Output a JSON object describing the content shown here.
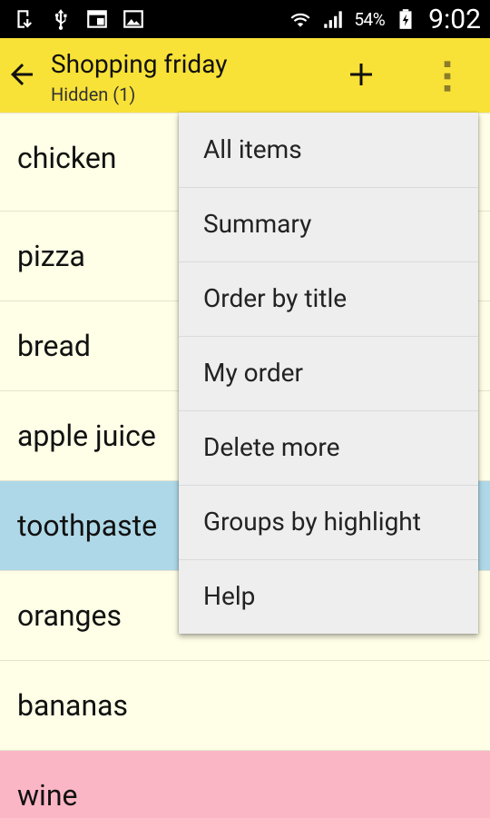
{
  "status_bar": {
    "battery_percent": "54%",
    "time": "9:02"
  },
  "app_bar": {
    "title": "Shopping friday",
    "subtitle": "Hidden (1)"
  },
  "list": {
    "items": [
      {
        "label": "chicken",
        "highlight": "none"
      },
      {
        "label": "pizza",
        "highlight": "none"
      },
      {
        "label": "bread",
        "highlight": "none"
      },
      {
        "label": "apple juice",
        "highlight": "none"
      },
      {
        "label": "toothpaste",
        "highlight": "#aed8e7"
      },
      {
        "label": "oranges",
        "highlight": "none"
      },
      {
        "label": "bananas",
        "highlight": "none"
      },
      {
        "label": "wine",
        "highlight": "#fbb6c6"
      }
    ]
  },
  "menu": {
    "items": [
      {
        "label": "All items"
      },
      {
        "label": "Summary"
      },
      {
        "label": "Order by title"
      },
      {
        "label": "My order"
      },
      {
        "label": "Delete more"
      },
      {
        "label": "Groups by highlight"
      },
      {
        "label": "Help"
      }
    ]
  },
  "colors": {
    "app_bar": "#f9e237",
    "list_background": "#fffee6",
    "menu_background": "#eeeeee"
  }
}
